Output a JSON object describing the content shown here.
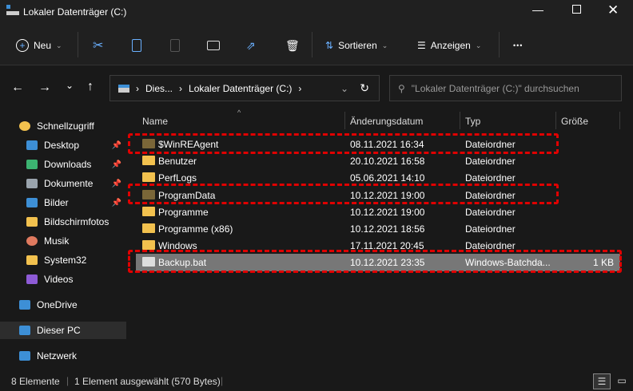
{
  "window": {
    "title": "Lokaler Datenträger (C:)",
    "controls": [
      "minimize",
      "maximize",
      "close"
    ]
  },
  "toolbar": {
    "new_label": "Neu",
    "sort_label": "Sortieren",
    "view_label": "Anzeigen",
    "more": "•••"
  },
  "address": {
    "crumbs": [
      "Dies...",
      "Lokaler Datenträger (C:)"
    ],
    "search_placeholder": "\"Lokaler Datenträger (C:)\" durchsuchen"
  },
  "sidebar": {
    "items": [
      {
        "label": "Schnellzugriff",
        "icon": "star-icon",
        "color": "#f2c14e"
      },
      {
        "label": "Desktop",
        "icon": "desktop-icon",
        "color": "#3d8fd6",
        "pinned": true
      },
      {
        "label": "Downloads",
        "icon": "download-icon",
        "color": "#3cb371",
        "pinned": true
      },
      {
        "label": "Dokumente",
        "icon": "document-icon",
        "color": "#9aa4ad",
        "pinned": true
      },
      {
        "label": "Bilder",
        "icon": "pictures-icon",
        "color": "#3d8fd6",
        "pinned": true
      },
      {
        "label": "Bildschirmfotos",
        "icon": "folder-icon",
        "color": "#f2c14e"
      },
      {
        "label": "Musik",
        "icon": "music-icon",
        "color": "#e07a5f"
      },
      {
        "label": "System32",
        "icon": "folder-icon",
        "color": "#f2c14e"
      },
      {
        "label": "Videos",
        "icon": "video-icon",
        "color": "#8e5bd6"
      },
      {
        "label": "OneDrive",
        "icon": "cloud-icon",
        "color": "#3d8fd6"
      },
      {
        "label": "Dieser PC",
        "icon": "pc-icon",
        "color": "#3d8fd6",
        "selected": true
      },
      {
        "label": "Netzwerk",
        "icon": "network-icon",
        "color": "#3d8fd6"
      }
    ]
  },
  "columns": [
    "Name",
    "Änderungsdatum",
    "Typ",
    "Größe"
  ],
  "files": [
    {
      "name": "$WinREAgent",
      "date": "08.11.2021 16:34",
      "type": "Dateiordner",
      "size": "",
      "hidden": true
    },
    {
      "name": "Benutzer",
      "date": "20.10.2021 16:58",
      "type": "Dateiordner",
      "size": ""
    },
    {
      "name": "PerfLogs",
      "date": "05.06.2021 14:10",
      "type": "Dateiordner",
      "size": ""
    },
    {
      "name": "ProgramData",
      "date": "10.12.2021 19:00",
      "type": "Dateiordner",
      "size": "",
      "hidden": true
    },
    {
      "name": "Programme",
      "date": "10.12.2021 19:00",
      "type": "Dateiordner",
      "size": ""
    },
    {
      "name": "Programme (x86)",
      "date": "10.12.2021 18:56",
      "type": "Dateiordner",
      "size": ""
    },
    {
      "name": "Windows",
      "date": "17.11.2021 20:45",
      "type": "Dateiordner",
      "size": ""
    },
    {
      "name": "Backup.bat",
      "date": "10.12.2021 23:35",
      "type": "Windows-Batchda...",
      "size": "1 KB",
      "selected": true
    }
  ],
  "status": {
    "count": "8 Elemente",
    "selection": "1 Element ausgewählt (570 Bytes)"
  }
}
